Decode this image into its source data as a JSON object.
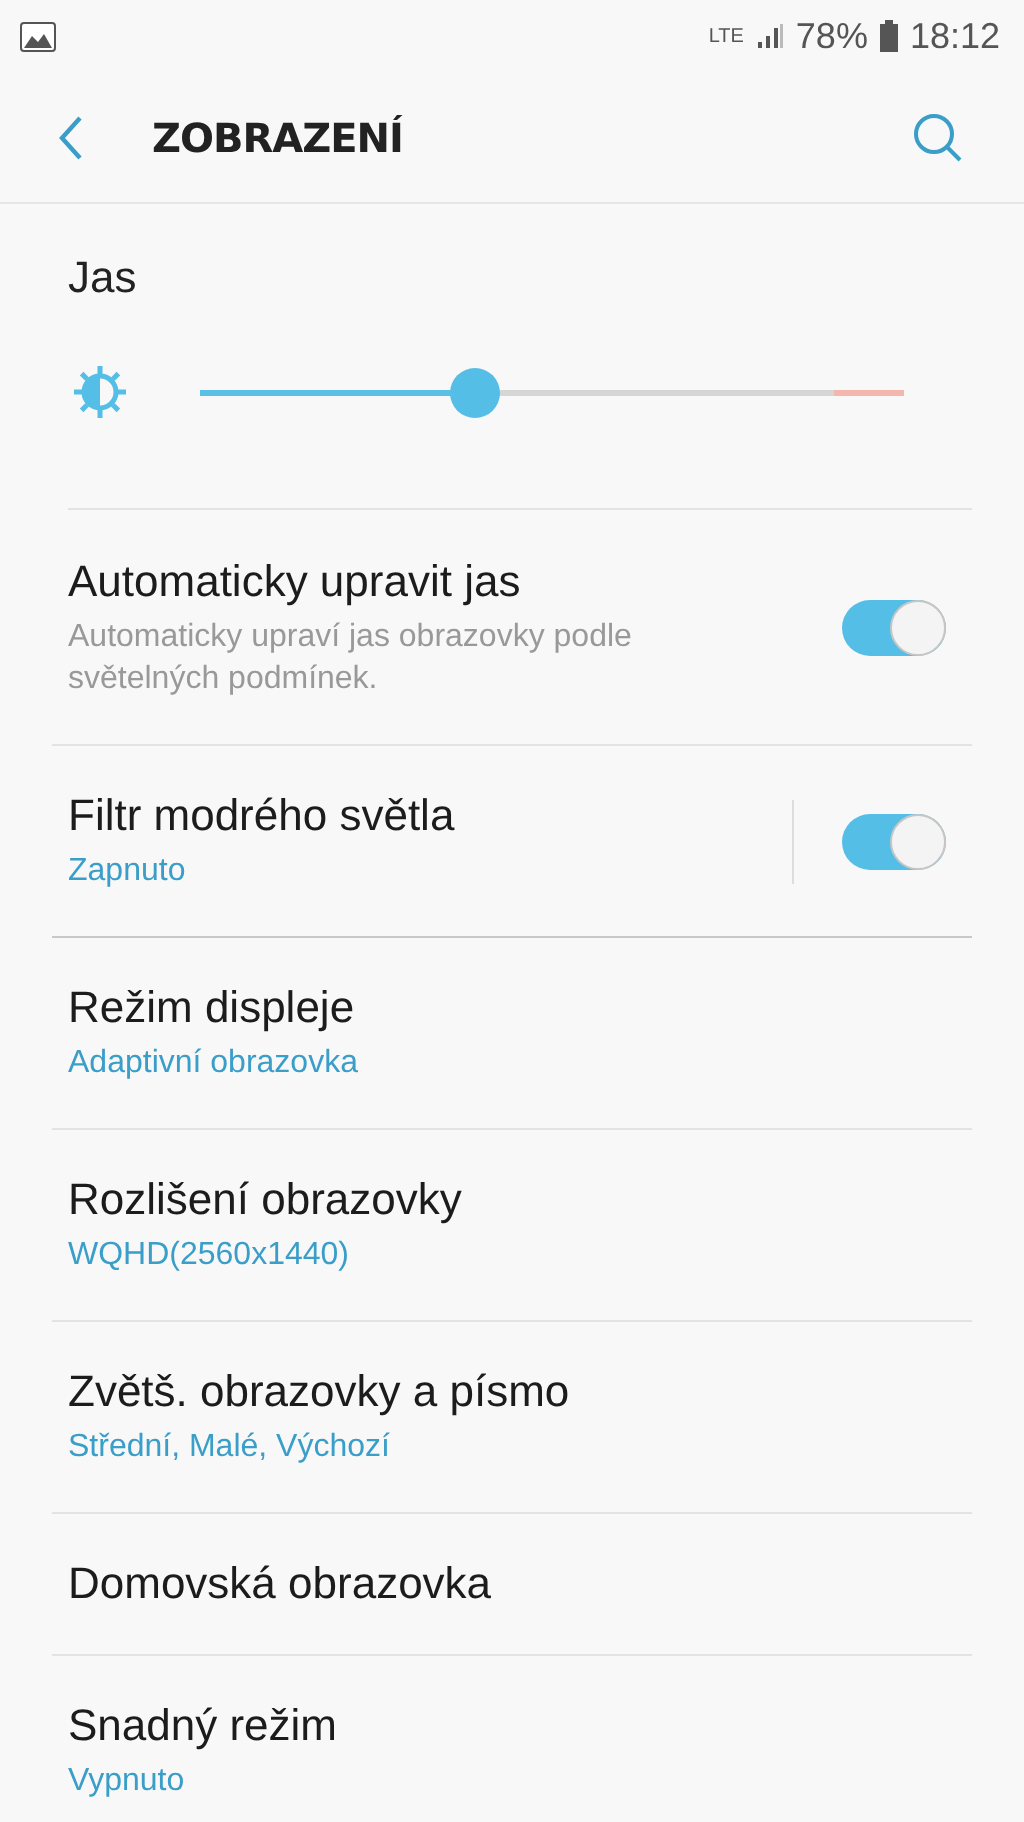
{
  "status_bar": {
    "network": "LTE",
    "battery": "78%",
    "time": "18:12"
  },
  "header": {
    "title": "ZOBRAZENÍ"
  },
  "brightness": {
    "title": "Jas",
    "level": 0.39
  },
  "items": [
    {
      "kind": "toggle",
      "title": "Automaticky upravit jas",
      "description": "Automaticky upraví jas obrazovky podle světelných podmínek.",
      "on": true,
      "divider": false
    },
    {
      "kind": "toggle",
      "title": "Filtr modrého světla",
      "value": "Zapnuto",
      "on": true,
      "divider": true
    },
    {
      "kind": "nav",
      "title": "Režim displeje",
      "value": "Adaptivní obrazovka"
    },
    {
      "kind": "nav",
      "title": "Rozlišení obrazovky",
      "value": "WQHD(2560x1440)"
    },
    {
      "kind": "nav",
      "title": "Zvětš. obrazovky a písmo",
      "value": "Střední, Malé, Výchozí"
    },
    {
      "kind": "nav",
      "title": "Domovská obrazovka"
    },
    {
      "kind": "nav",
      "title": "Snadný režim",
      "value": "Vypnuto"
    }
  ]
}
